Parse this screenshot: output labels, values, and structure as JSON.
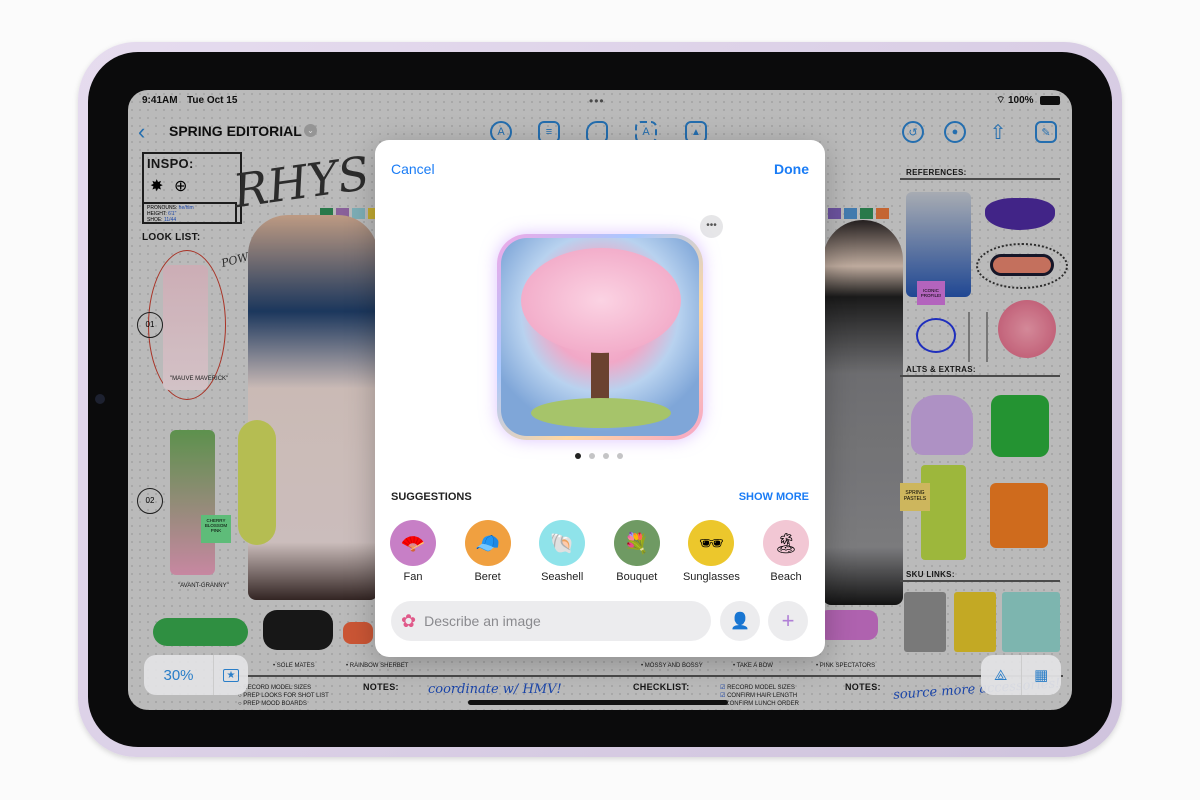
{
  "status_bar": {
    "time": "9:41AM",
    "date": "Tue Oct 15",
    "battery": "100%"
  },
  "toolbar": {
    "title": "SPRING EDITORIAL",
    "left_icons": [
      "back-chevron-icon",
      "title-dropdown-icon"
    ],
    "center_icons": [
      "pen-tool-icon",
      "sticky-note-icon",
      "shapes-icon",
      "text-box-icon",
      "media-icon"
    ],
    "right_icons": [
      "undo-history-icon",
      "collaborate-icon",
      "share-icon",
      "compose-icon"
    ]
  },
  "canvas": {
    "inspo": {
      "heading": "INSPO:",
      "pronouns_label": "PRONOUNS:",
      "pronouns_value": "he/him",
      "height_label": "HEIGHT:",
      "height_value": "6'1\"",
      "shoe_label": "SHOE:",
      "shoe_value": "11/44",
      "signature": "RHYS"
    },
    "look_list": {
      "heading": "LOOK LIST:",
      "look1_num": "01",
      "look1_name": "\"MAUVE MAVERICK\"",
      "look2_num": "02",
      "look2_name": "\"AVANT-GRANNY\"",
      "note_pink": "POWER IN PINK",
      "sticky": "CHERRY BLOSSOM PINK"
    },
    "swatches": [
      "#2f8a55",
      "#9c6fb0",
      "#8fc7d0",
      "#e0c43a"
    ],
    "bullets_left": [
      "SOLE MATES",
      "RAINBOW SHERBET"
    ],
    "bullets_right": [
      "MOSSY AND BOSSY",
      "TAKE A BOW",
      "PINK SPECTATORS"
    ],
    "todo_left": [
      "RECORD MODEL SIZES",
      "PREP LOOKS FOR SHOT LIST",
      "PREP MOOD BOARDS"
    ],
    "notes_heading": "NOTES:",
    "notes_left": "coordinate w/ HMV!",
    "checklist_heading": "CHECKLIST:",
    "checklist": [
      {
        "label": "RECORD MODEL SIZES",
        "checked": true
      },
      {
        "label": "CONFIRM HAIR LENGTH",
        "checked": true
      },
      {
        "label": "CONFIRM LUNCH ORDER",
        "checked": false
      }
    ],
    "notes_right": "source more accessories!",
    "references_heading": "REFERENCES:",
    "iconic_sticky": "ICONIC PROFILE!",
    "alts_heading": "ALTS & EXTRAS:",
    "spring_sticky": "SPRING PASTELS",
    "sku_heading": "SKU LINKS:"
  },
  "zoom": {
    "level": "30%"
  },
  "modal": {
    "cancel": "Cancel",
    "done": "Done",
    "page_count": 4,
    "page_index": 0,
    "suggestions_heading": "SUGGESTIONS",
    "show_more": "SHOW MORE",
    "suggestions": [
      {
        "label": "Fan",
        "color": "#c77fc6",
        "emoji": "🪭"
      },
      {
        "label": "Beret",
        "color": "#f0a040",
        "emoji": "🧢"
      },
      {
        "label": "Seashell",
        "color": "#8fe3ea",
        "emoji": "🐚"
      },
      {
        "label": "Bouquet",
        "color": "#6f9a63",
        "emoji": "💐"
      },
      {
        "label": "Sunglasses",
        "color": "#ecc72c",
        "emoji": "🕶"
      },
      {
        "label": "Beach",
        "color": "#f2c7d4",
        "emoji": "🏝"
      }
    ],
    "input_placeholder": "Describe an image",
    "accent": "#1a7cf5"
  }
}
